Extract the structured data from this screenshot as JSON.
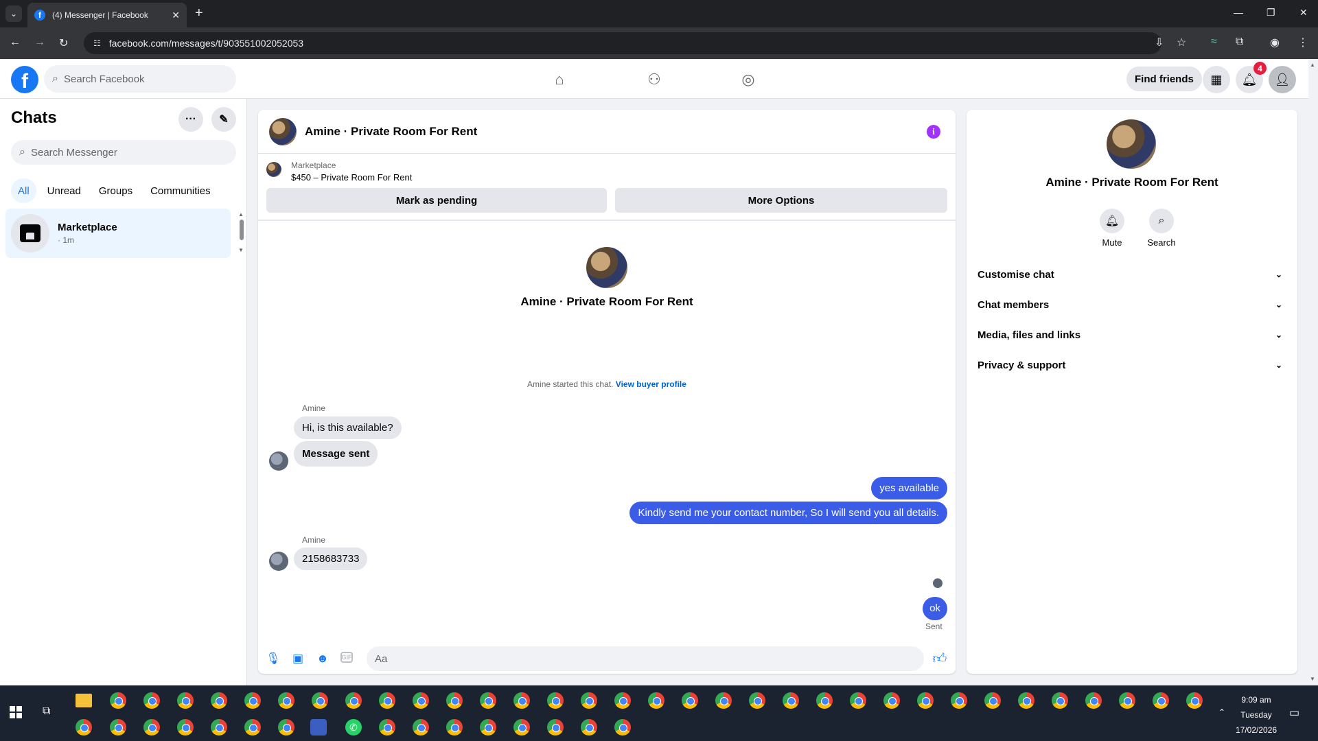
{
  "browser": {
    "tab_title": "(4) Messenger | Facebook",
    "url": "facebook.com/messages/t/903551002052053"
  },
  "header": {
    "search_placeholder": "Search Facebook",
    "find_friends": "Find friends",
    "notification_count": "4"
  },
  "chats": {
    "title": "Chats",
    "search_placeholder": "Search Messenger",
    "filters": [
      "All",
      "Unread",
      "Groups",
      "Communities"
    ],
    "items": [
      {
        "name": "Marketplace",
        "time": "· 1m"
      }
    ]
  },
  "conversation": {
    "title": "Amine · Private Room For Rent",
    "marketplace_label": "Marketplace",
    "listing": "$450 – Private Room For Rent",
    "mark_pending": "Mark as pending",
    "more_options": "More Options",
    "intro_name": "Amine · Private Room For Rent",
    "started_text": "Amine started this chat.",
    "view_buyer": "View buyer profile",
    "messages": [
      {
        "sender": "Amine",
        "text": "Hi, is this available?"
      },
      {
        "text": "Message sent"
      },
      {
        "text": "yes available"
      },
      {
        "text": "Kindly send me your contact number, So I will send you all details."
      },
      {
        "sender": "Amine",
        "text": "2158683733"
      },
      {
        "text": "ok"
      }
    ],
    "sent_status": "Sent",
    "composer_placeholder": "Aa"
  },
  "details": {
    "name": "Amine · Private Room For Rent",
    "mute": "Mute",
    "search": "Search",
    "sections": [
      "Customise chat",
      "Chat members",
      "Media, files and links",
      "Privacy & support"
    ]
  },
  "taskbar": {
    "time": "9:09 am",
    "day": "Tuesday",
    "date": "17/02/2026"
  }
}
